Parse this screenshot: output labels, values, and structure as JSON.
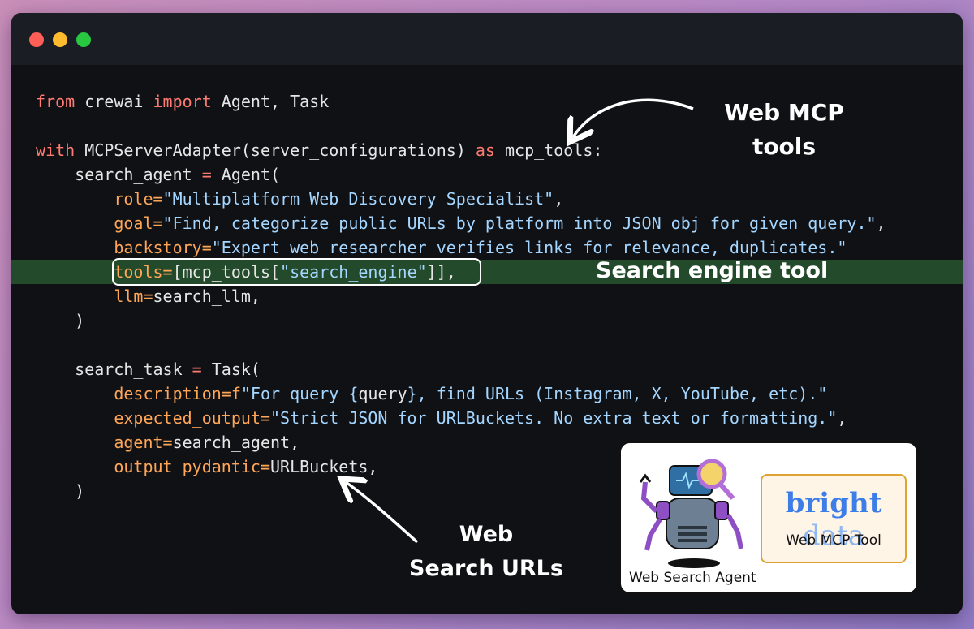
{
  "code": {
    "l1": {
      "a": "from",
      "b": " crewai ",
      "c": "import",
      "d": " Agent, Task"
    },
    "l3": {
      "a": "with",
      "b": " MCPServerAdapter(server_configurations) ",
      "c": "as",
      "d": " mcp_tools:"
    },
    "l4": {
      "a": "    search_agent ",
      "b": "=",
      "c": " Agent("
    },
    "l5": {
      "a": "        ",
      "b": "role=",
      "c": "\"Multiplatform Web Discovery Specialist\"",
      "d": ","
    },
    "l6": {
      "a": "        ",
      "b": "goal=",
      "c": "\"Find, categorize public URLs by platform into JSON obj for given query.\"",
      "d": ","
    },
    "l7": {
      "a": "        ",
      "b": "backstory=",
      "c": "\"Expert web researcher verifies links for relevance, duplicates.\""
    },
    "l8": {
      "a": "        ",
      "b": "tools=",
      "c": "[mcp_tools[",
      "d": "\"search_engine\"",
      "e": "]],"
    },
    "l9": {
      "a": "        ",
      "b": "llm=",
      "c": "search_llm,"
    },
    "l10": {
      "a": "    )"
    },
    "l12": {
      "a": "    search_task ",
      "b": "=",
      "c": " Task("
    },
    "l13": {
      "a": "        ",
      "b": "description=f",
      "c": "\"For query {",
      "d": "query",
      "e": "}, find URLs (Instagram, X, YouTube, etc).\""
    },
    "l14": {
      "a": "        ",
      "b": "expected_output=",
      "c": "\"Strict JSON for URLBuckets. No extra text or formatting.\"",
      "d": ","
    },
    "l15": {
      "a": "        ",
      "b": "agent=",
      "c": "search_agent,"
    },
    "l16": {
      "a": "        ",
      "b": "output_pydantic=",
      "c": "URLBuckets,"
    },
    "l17": {
      "a": "    )"
    }
  },
  "annotations": {
    "mcp_line1": "Web MCP",
    "mcp_line2": "tools",
    "engine": "Search engine tool",
    "urls_line1": "Web",
    "urls_line2": "Search URLs"
  },
  "card": {
    "agent_label": "Web Search Agent",
    "logo_bold": "bright",
    "logo_light": "data",
    "tool_label": "Web MCP Tool"
  },
  "colors": {
    "keyword": "#ff7b72",
    "kwarg": "#ffa657",
    "string": "#a5d6ff",
    "highlight": "#234a2a"
  }
}
